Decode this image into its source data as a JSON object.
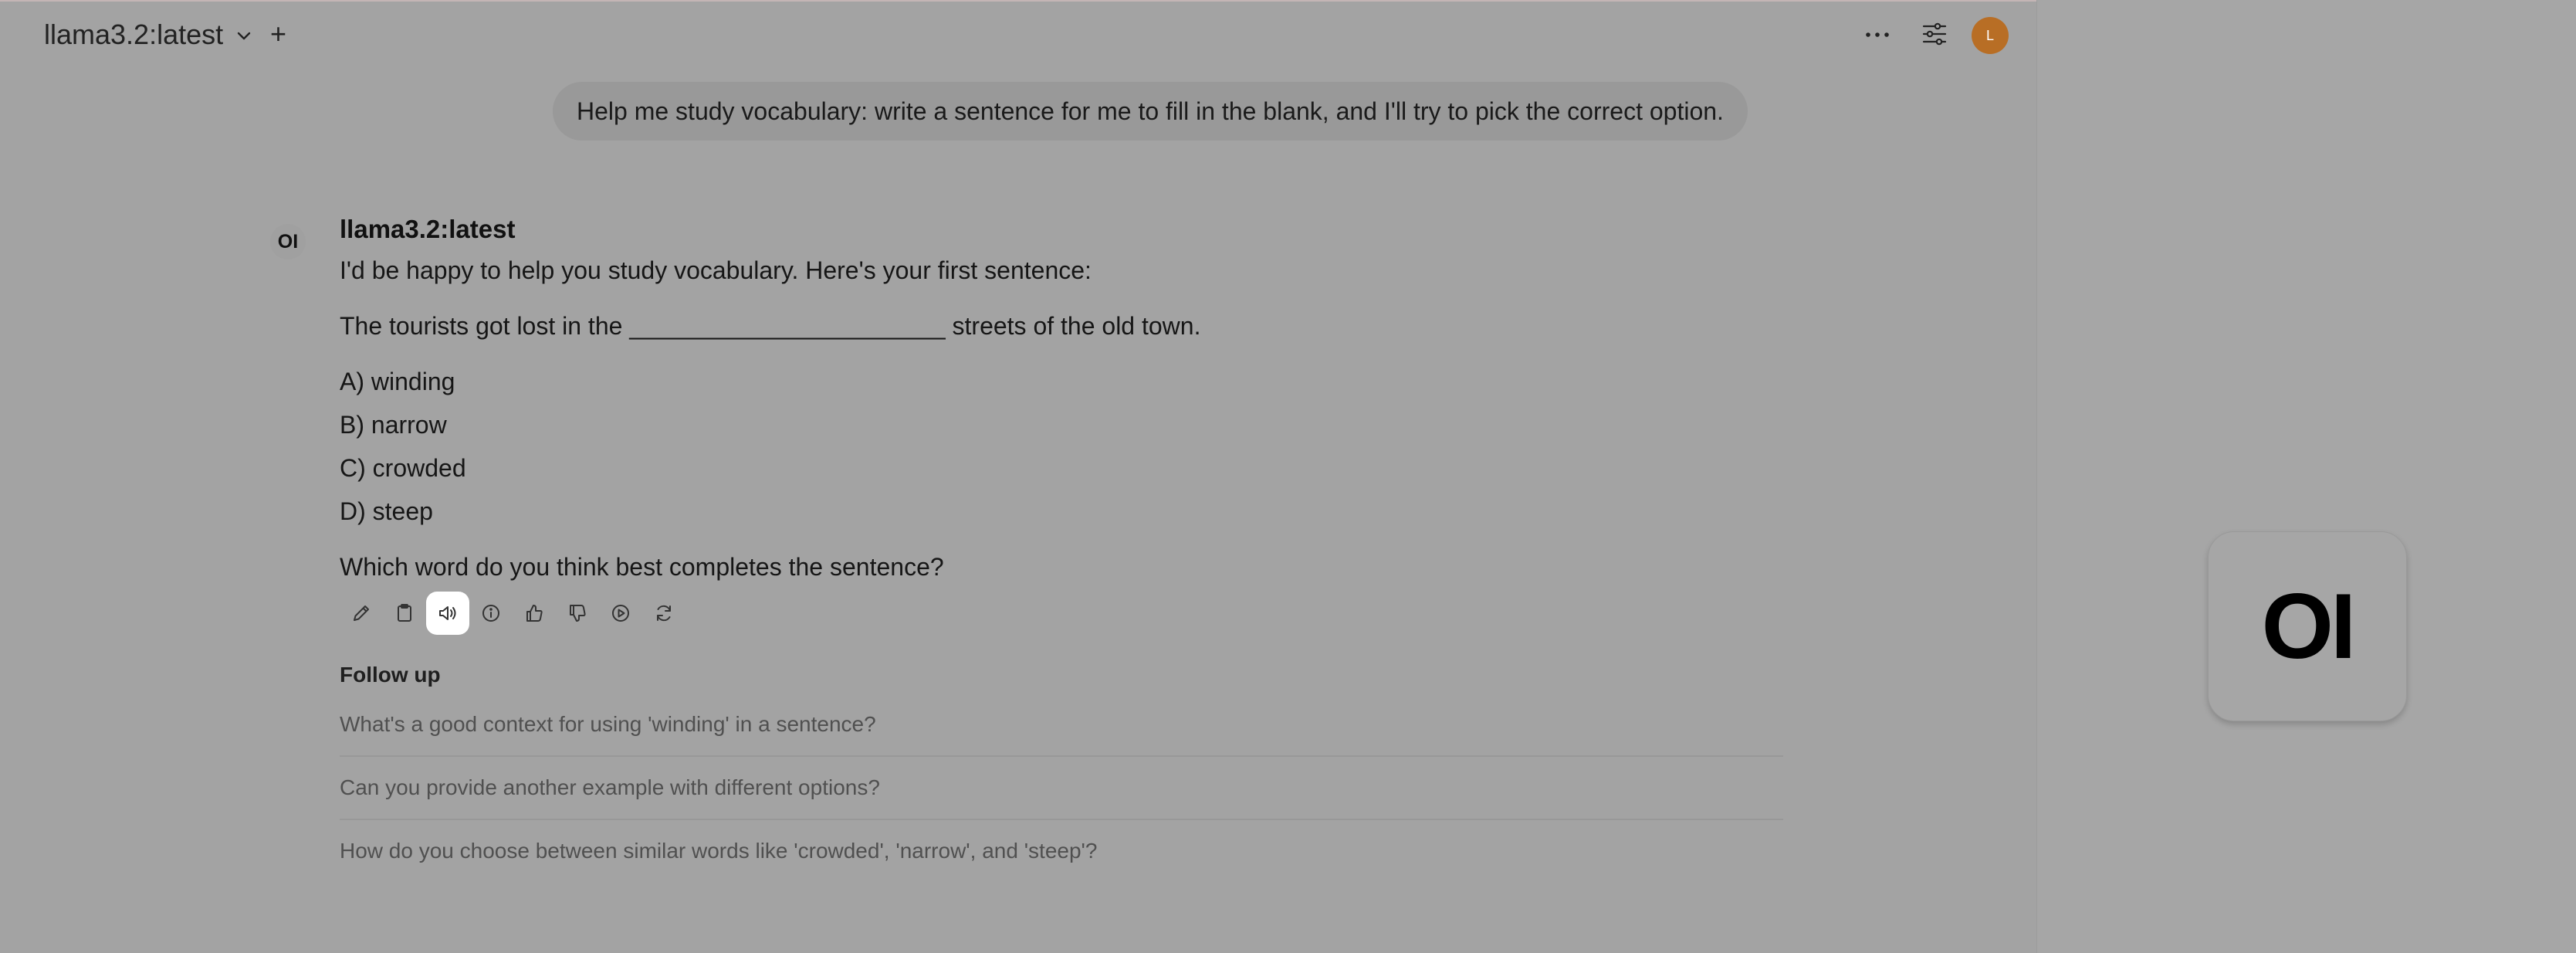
{
  "header": {
    "model_name": "llama3.2:latest",
    "new_chat_symbol": "+",
    "avatar_initial": "L",
    "avatar_color": "#b86e25"
  },
  "icons": [
    "chevron-down-icon",
    "ellipsis-icon",
    "sliders-icon",
    "pencil-icon",
    "clipboard-icon",
    "speaker-icon",
    "info-icon",
    "thumbs-up-icon",
    "thumbs-down-icon",
    "play-circle-icon",
    "refresh-icon"
  ],
  "user_message": "Help me study vocabulary: write a sentence for me to fill in the blank, and I'll try to pick the correct option.",
  "assistant": {
    "avatar_text": "OI",
    "name": "llama3.2:latest",
    "intro": "I'd be happy to help you study vocabulary. Here's your first sentence:",
    "sentence": "The tourists got lost in the _______________________ streets of the old town.",
    "options": [
      "A) winding",
      "B) narrow",
      "C) crowded",
      "D) steep"
    ],
    "question": "Which word do you think best completes the sentence?"
  },
  "follow_up": {
    "title": "Follow up",
    "items": [
      "What's a good context for using 'winding' in a sentence?",
      "Can you provide another example with different options?",
      "How do you choose between similar words like 'crowded', 'narrow', and 'steep'?"
    ]
  },
  "logo_tile_text": "OI"
}
